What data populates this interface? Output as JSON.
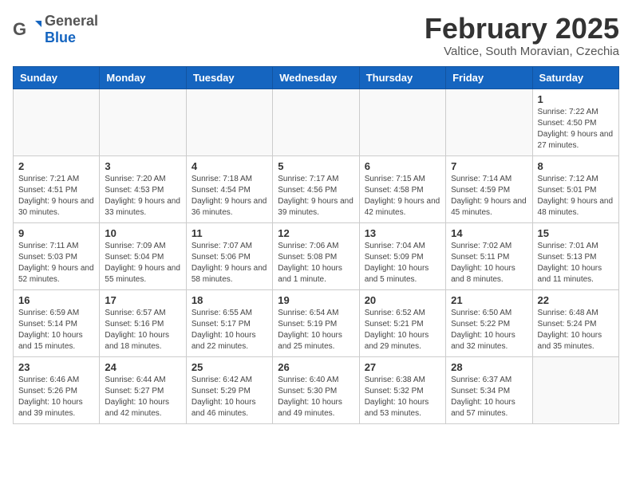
{
  "header": {
    "logo_general": "General",
    "logo_blue": "Blue",
    "month_title": "February 2025",
    "subtitle": "Valtice, South Moravian, Czechia"
  },
  "weekdays": [
    "Sunday",
    "Monday",
    "Tuesday",
    "Wednesday",
    "Thursday",
    "Friday",
    "Saturday"
  ],
  "weeks": [
    [
      {
        "day": "",
        "info": ""
      },
      {
        "day": "",
        "info": ""
      },
      {
        "day": "",
        "info": ""
      },
      {
        "day": "",
        "info": ""
      },
      {
        "day": "",
        "info": ""
      },
      {
        "day": "",
        "info": ""
      },
      {
        "day": "1",
        "info": "Sunrise: 7:22 AM\nSunset: 4:50 PM\nDaylight: 9 hours and 27 minutes."
      }
    ],
    [
      {
        "day": "2",
        "info": "Sunrise: 7:21 AM\nSunset: 4:51 PM\nDaylight: 9 hours and 30 minutes."
      },
      {
        "day": "3",
        "info": "Sunrise: 7:20 AM\nSunset: 4:53 PM\nDaylight: 9 hours and 33 minutes."
      },
      {
        "day": "4",
        "info": "Sunrise: 7:18 AM\nSunset: 4:54 PM\nDaylight: 9 hours and 36 minutes."
      },
      {
        "day": "5",
        "info": "Sunrise: 7:17 AM\nSunset: 4:56 PM\nDaylight: 9 hours and 39 minutes."
      },
      {
        "day": "6",
        "info": "Sunrise: 7:15 AM\nSunset: 4:58 PM\nDaylight: 9 hours and 42 minutes."
      },
      {
        "day": "7",
        "info": "Sunrise: 7:14 AM\nSunset: 4:59 PM\nDaylight: 9 hours and 45 minutes."
      },
      {
        "day": "8",
        "info": "Sunrise: 7:12 AM\nSunset: 5:01 PM\nDaylight: 9 hours and 48 minutes."
      }
    ],
    [
      {
        "day": "9",
        "info": "Sunrise: 7:11 AM\nSunset: 5:03 PM\nDaylight: 9 hours and 52 minutes."
      },
      {
        "day": "10",
        "info": "Sunrise: 7:09 AM\nSunset: 5:04 PM\nDaylight: 9 hours and 55 minutes."
      },
      {
        "day": "11",
        "info": "Sunrise: 7:07 AM\nSunset: 5:06 PM\nDaylight: 9 hours and 58 minutes."
      },
      {
        "day": "12",
        "info": "Sunrise: 7:06 AM\nSunset: 5:08 PM\nDaylight: 10 hours and 1 minute."
      },
      {
        "day": "13",
        "info": "Sunrise: 7:04 AM\nSunset: 5:09 PM\nDaylight: 10 hours and 5 minutes."
      },
      {
        "day": "14",
        "info": "Sunrise: 7:02 AM\nSunset: 5:11 PM\nDaylight: 10 hours and 8 minutes."
      },
      {
        "day": "15",
        "info": "Sunrise: 7:01 AM\nSunset: 5:13 PM\nDaylight: 10 hours and 11 minutes."
      }
    ],
    [
      {
        "day": "16",
        "info": "Sunrise: 6:59 AM\nSunset: 5:14 PM\nDaylight: 10 hours and 15 minutes."
      },
      {
        "day": "17",
        "info": "Sunrise: 6:57 AM\nSunset: 5:16 PM\nDaylight: 10 hours and 18 minutes."
      },
      {
        "day": "18",
        "info": "Sunrise: 6:55 AM\nSunset: 5:17 PM\nDaylight: 10 hours and 22 minutes."
      },
      {
        "day": "19",
        "info": "Sunrise: 6:54 AM\nSunset: 5:19 PM\nDaylight: 10 hours and 25 minutes."
      },
      {
        "day": "20",
        "info": "Sunrise: 6:52 AM\nSunset: 5:21 PM\nDaylight: 10 hours and 29 minutes."
      },
      {
        "day": "21",
        "info": "Sunrise: 6:50 AM\nSunset: 5:22 PM\nDaylight: 10 hours and 32 minutes."
      },
      {
        "day": "22",
        "info": "Sunrise: 6:48 AM\nSunset: 5:24 PM\nDaylight: 10 hours and 35 minutes."
      }
    ],
    [
      {
        "day": "23",
        "info": "Sunrise: 6:46 AM\nSunset: 5:26 PM\nDaylight: 10 hours and 39 minutes."
      },
      {
        "day": "24",
        "info": "Sunrise: 6:44 AM\nSunset: 5:27 PM\nDaylight: 10 hours and 42 minutes."
      },
      {
        "day": "25",
        "info": "Sunrise: 6:42 AM\nSunset: 5:29 PM\nDaylight: 10 hours and 46 minutes."
      },
      {
        "day": "26",
        "info": "Sunrise: 6:40 AM\nSunset: 5:30 PM\nDaylight: 10 hours and 49 minutes."
      },
      {
        "day": "27",
        "info": "Sunrise: 6:38 AM\nSunset: 5:32 PM\nDaylight: 10 hours and 53 minutes."
      },
      {
        "day": "28",
        "info": "Sunrise: 6:37 AM\nSunset: 5:34 PM\nDaylight: 10 hours and 57 minutes."
      },
      {
        "day": "",
        "info": ""
      }
    ]
  ]
}
